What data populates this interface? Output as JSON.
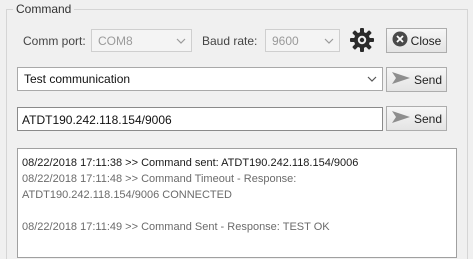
{
  "group": {
    "title": "Command"
  },
  "comm_port": {
    "label": "Comm port:",
    "value": "COM8"
  },
  "baud_rate": {
    "label": "Baud rate:",
    "value": "9600"
  },
  "icons": {
    "settings": "gear-icon",
    "close": "x-circle-icon",
    "send": "send-arrow-icon"
  },
  "close_button": {
    "label": "Close"
  },
  "command_select": {
    "value": "Test communication"
  },
  "command_input": {
    "value": "ATDT190.242.118.154/9006"
  },
  "send_button_1": {
    "label": "Send"
  },
  "send_button_2": {
    "label": "Send"
  },
  "log": {
    "entries": [
      "08/22/2018 17:11:38 >> Command sent: ATDT190.242.118.154/9006",
      "08/22/2018 17:11:48 >> Command Timeout - Response:",
      "ATDT190.242.118.154/9006  CONNECTED",
      "08/22/2018 17:11:49 >> Command Sent - Response: TEST OK"
    ]
  },
  "colors": {
    "window_bg": "#f0f0f0",
    "field_border": "#8a8a8a",
    "disabled_text": "#9a9a9a"
  }
}
